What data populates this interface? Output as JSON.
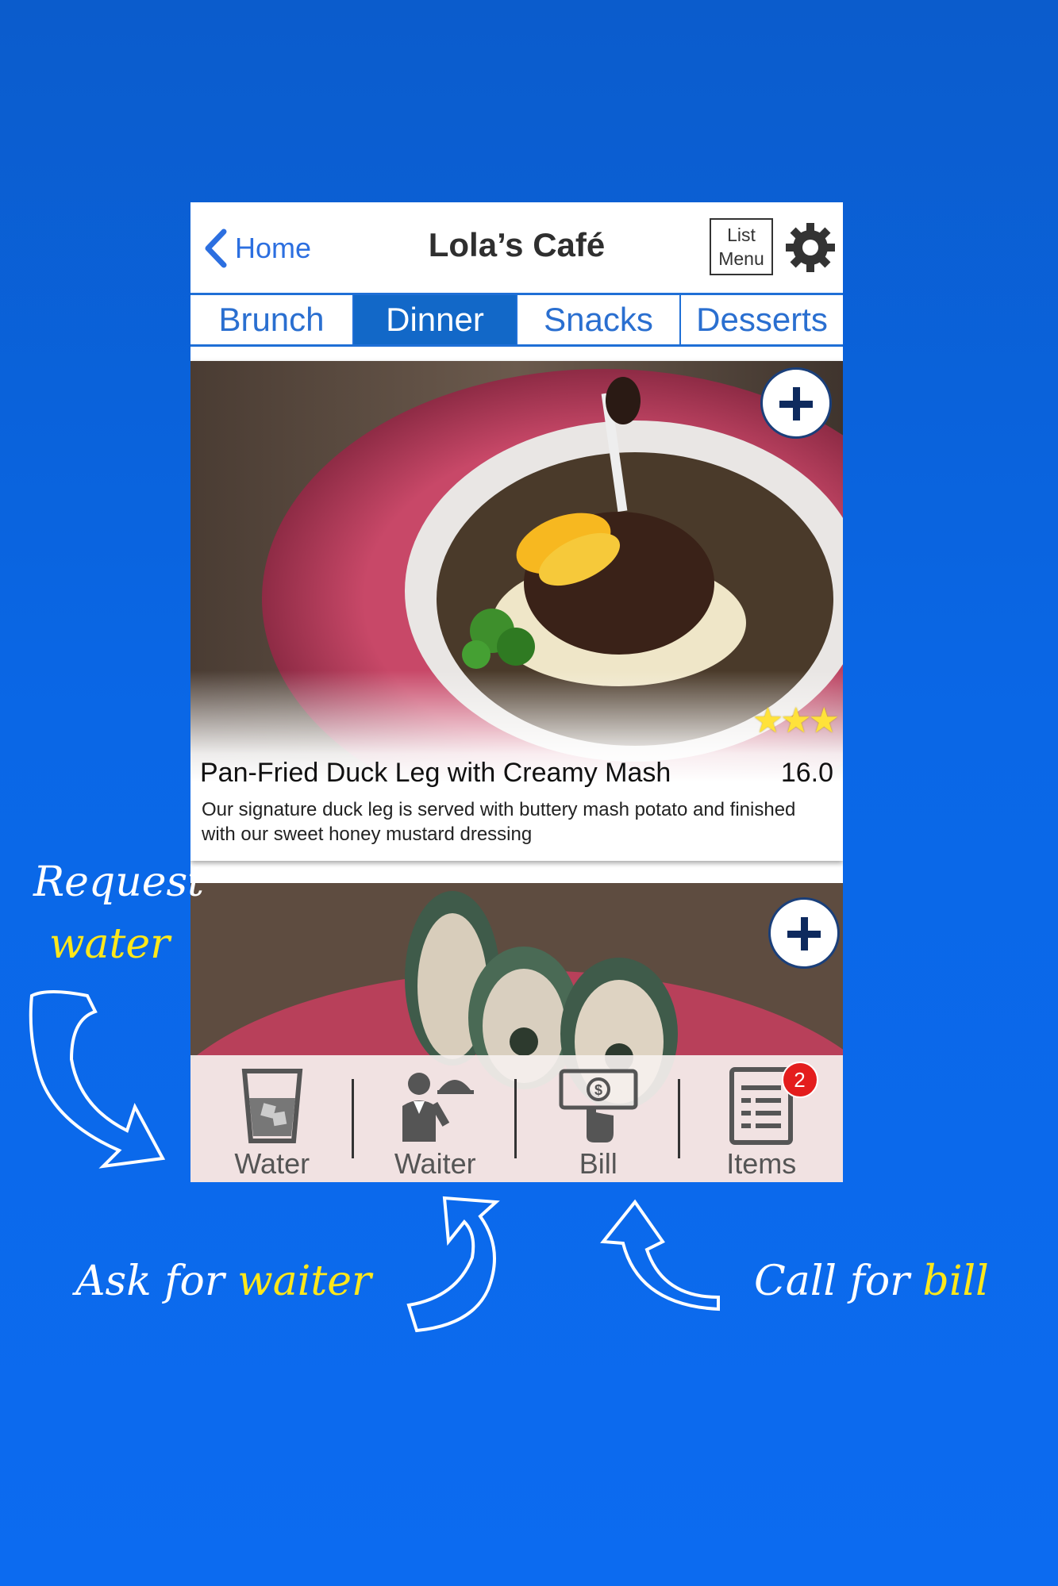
{
  "header": {
    "back_label": "Home",
    "title": "Lola’s Café",
    "list_menu_line1": "List",
    "list_menu_line2": "Menu"
  },
  "tabs": [
    {
      "label": "Brunch",
      "active": false
    },
    {
      "label": "Dinner",
      "active": true
    },
    {
      "label": "Snacks",
      "active": false
    },
    {
      "label": "Desserts",
      "active": false
    }
  ],
  "items": [
    {
      "name": "Pan-Fried Duck Leg with Creamy Mash",
      "price": "16.0",
      "description": "Our signature duck leg is served with buttery mash potato and finished with our sweet honey mustard dressing",
      "rating": 3
    }
  ],
  "bottom_bar": {
    "water": "Water",
    "waiter": "Waiter",
    "bill": "Bill",
    "items": "Items",
    "items_badge": "2"
  },
  "annotations": {
    "request_line1": "Request",
    "request_line2": "water",
    "waiter_prefix": "Ask for ",
    "waiter_highlight": "waiter",
    "bill_prefix": "Call for ",
    "bill_highlight": "bill"
  },
  "colors": {
    "background": "#0a67e6",
    "tab_active": "#1268c8",
    "accent_text": "#2c6fe0",
    "highlight": "#ffe81a",
    "badge": "#e41d1d"
  }
}
